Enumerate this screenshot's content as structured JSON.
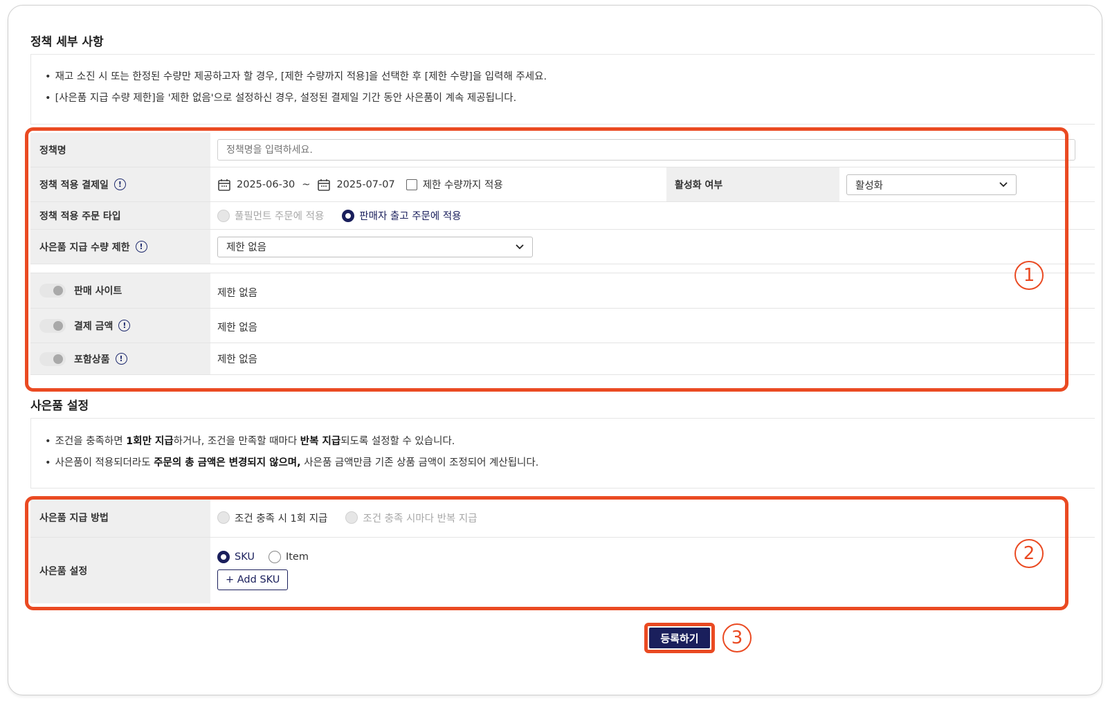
{
  "policy_details": {
    "title": "정책 세부 사항",
    "notes": [
      "재고 소진 시 또는 한정된 수량만 제공하고자 할 경우, [제한 수량까지 적용]을 선택한 후 [제한 수량]을 입력해 주세요.",
      "[사은품 지급 수량 제한]을 '제한 없음'으로 설정하신 경우, 설정된 결제일 기간 동안 사은품이 계속 제공됩니다."
    ]
  },
  "policy_form": {
    "name_label": "정책명",
    "name_placeholder": "정책명을 입력하세요.",
    "date_label": "정책 적용 결제일",
    "date_start": "2025-06-30",
    "date_sep": "~",
    "date_end": "2025-07-07",
    "limit_checkbox_label": "제한 수량까지 적용",
    "active_label": "활성화 여부",
    "active_value": "활성화",
    "order_type_label": "정책 적용 주문 타입",
    "order_type_options": [
      "풀필먼트 주문에 적용",
      "판매자 출고 주문에 적용"
    ],
    "quantity_limit_label": "사은품 지급 수량 제한",
    "quantity_limit_value": "제한 없음",
    "conditions": [
      {
        "label": "판매 사이트",
        "value": "제한 없음"
      },
      {
        "label": "결제 금액",
        "value": "제한 없음"
      },
      {
        "label": "포함상품",
        "value": "제한 없음"
      }
    ]
  },
  "gift_settings": {
    "title": "사은품 설정",
    "note1_a": "조건을 충족하면 ",
    "note1_b": "1회만 지급",
    "note1_c": "하거나, 조건을 만족할 때마다 ",
    "note1_d": "반복 지급",
    "note1_e": "되도록 설정할 수 있습니다.",
    "note2_a": "사은품이 적용되더라도 ",
    "note2_b": "주문의 총 금액은 변경되지 않으며,",
    "note2_c": " 사은품 금액만큼 기존 상품 금액이 조정되어 계산됩니다."
  },
  "gift_form": {
    "method_label": "사은품 지급 방법",
    "method_options": [
      "조건 충족 시 1회 지급",
      "조건 충족 시마다 반복 지급"
    ],
    "setting_label": "사은품 설정",
    "setting_options": [
      "SKU",
      "Item"
    ],
    "add_sku_label": "+ Add SKU"
  },
  "submit_label": "등록하기",
  "markers": [
    "1",
    "2",
    "3"
  ],
  "accent_color": "#ea4a22",
  "primary_color": "#1a1f5c"
}
